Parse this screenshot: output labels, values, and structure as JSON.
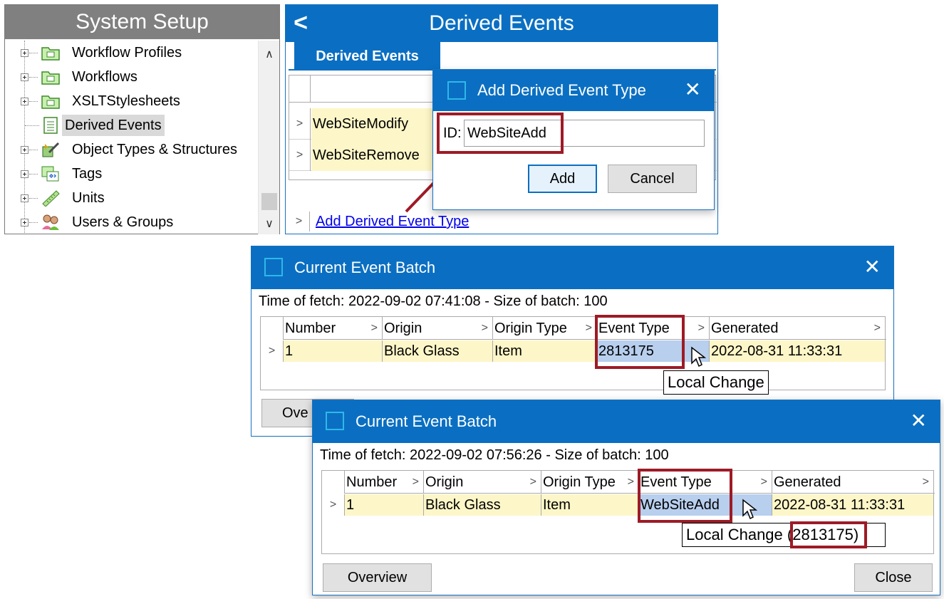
{
  "system_setup": {
    "title": "System Setup",
    "items": [
      {
        "label": "Workflow Profiles",
        "icon": "folder-icon"
      },
      {
        "label": "Workflows",
        "icon": "folder-icon"
      },
      {
        "label": "XSLTStylesheets",
        "icon": "folder-icon"
      },
      {
        "label": "Derived Events",
        "icon": "document-icon",
        "selected": true
      },
      {
        "label": "Object Types & Structures",
        "icon": "object-types-icon"
      },
      {
        "label": "Tags",
        "icon": "tags-icon"
      },
      {
        "label": "Units",
        "icon": "ruler-icon"
      },
      {
        "label": "Users & Groups",
        "icon": "users-icon"
      }
    ]
  },
  "derived_events": {
    "title": "Derived Events",
    "tab": "Derived Events",
    "rows": [
      "WebSiteModify",
      "WebSiteRemove"
    ],
    "add_link": "Add Derived Event Type"
  },
  "add_dialog": {
    "title": "Add Derived Event Type",
    "id_label": "ID:",
    "id_value": "WebSiteAdd",
    "add_button": "Add",
    "cancel_button": "Cancel"
  },
  "batch1": {
    "title": "Current Event Batch",
    "info": "Time of fetch: 2022-09-02 07:41:08  -  Size of batch: 100",
    "columns": [
      "Number",
      "Origin",
      "Origin Type",
      "Event Type",
      "Generated"
    ],
    "row": {
      "number": "1",
      "origin": "Black Glass",
      "origin_type": "Item",
      "event_type": "2813175",
      "generated": "2022-08-31 11:33:31"
    },
    "tooltip": "Local Change",
    "overview_button_partial": "Ove"
  },
  "batch2": {
    "title": "Current Event Batch",
    "info": "Time of fetch: 2022-09-02 07:56:26  -  Size of batch: 100",
    "columns": [
      "Number",
      "Origin",
      "Origin Type",
      "Event Type",
      "Generated"
    ],
    "row": {
      "number": "1",
      "origin": "Black Glass",
      "origin_type": "Item",
      "event_type": "WebSiteAdd",
      "generated": "2022-08-31 11:33:31"
    },
    "tooltip": "Local Change",
    "tooltip_value": "(2813175)",
    "overview_button": "Overview",
    "close_button": "Close"
  },
  "colors": {
    "accent": "#0a6fc2",
    "highlight_box": "#9d1b26",
    "row_fill": "#fdf6c8",
    "selected_cell": "#b8cfee",
    "link": "#0000ee"
  }
}
